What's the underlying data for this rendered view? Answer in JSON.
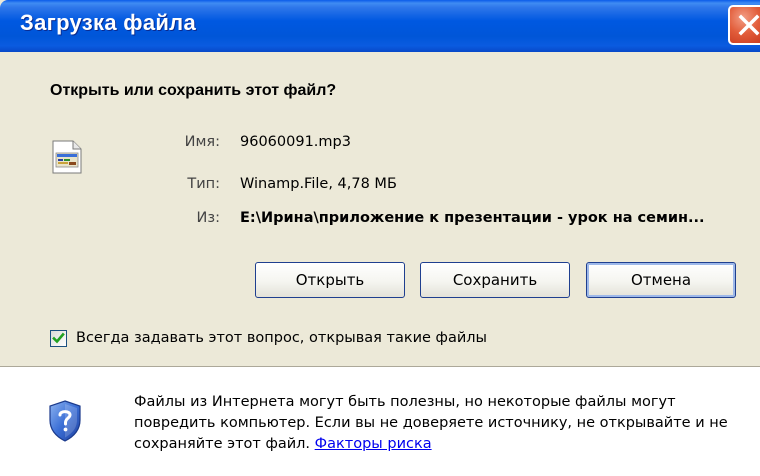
{
  "window": {
    "title": "Загрузка файла"
  },
  "dialog": {
    "question": "Открыть или сохранить этот файл?",
    "file_icon": "winamp-file-icon",
    "info": {
      "name_label": "Имя:",
      "name_value": "96060091.mp3",
      "type_label": "Тип:",
      "type_value": "Winamp.File, 4,78 МБ",
      "from_label": "Из:",
      "from_value": "E:\\Ирина\\приложение к презентации - урок на семин..."
    },
    "buttons": {
      "open": "Открыть",
      "save": "Сохранить",
      "cancel": "Отмена"
    },
    "checkbox": {
      "checked": true,
      "label": "Всегда задавать этот вопрос, открывая такие файлы"
    },
    "warning": {
      "icon": "security-shield-icon",
      "text": "Файлы из Интернета могут быть полезны, но некоторые файлы могут повредить компьютер. Если вы не доверяете источнику, не открывайте и не сохраняйте этот файл.",
      "link": "Факторы риска"
    }
  },
  "colors": {
    "titlebar": "#0058E1",
    "dialog_bg": "#ECE9D8",
    "close_button": "#E25D3A",
    "link": "#0000EE",
    "checkmark": "#21A121"
  }
}
